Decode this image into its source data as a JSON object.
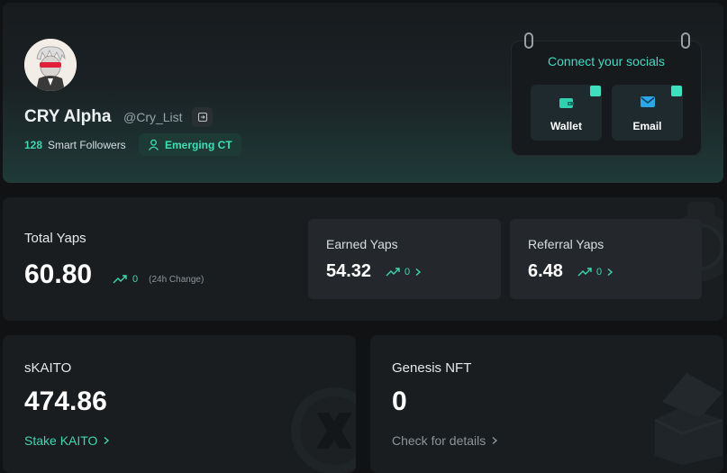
{
  "profile": {
    "name": "CRY Alpha",
    "handle": "@Cry_List",
    "followers_count": "128",
    "followers_label": "Smart Followers",
    "badge_label": "Emerging CT"
  },
  "socials": {
    "title": "Connect your socials",
    "wallet_label": "Wallet",
    "email_label": "Email"
  },
  "total_yaps": {
    "label": "Total Yaps",
    "value": "60.80",
    "change": "0",
    "change_note": "(24h Change)"
  },
  "earned_yaps": {
    "label": "Earned Yaps",
    "value": "54.32",
    "change": "0"
  },
  "referral_yaps": {
    "label": "Referral Yaps",
    "value": "6.48",
    "change": "0"
  },
  "skaito": {
    "label": "sKAITO",
    "value": "474.86",
    "link": "Stake KAITO"
  },
  "genesis": {
    "label": "Genesis NFT",
    "value": "0",
    "link": "Check for details"
  },
  "colors": {
    "accent": "#3fd6b0",
    "card": "#1a1d20",
    "background": "#101214"
  }
}
